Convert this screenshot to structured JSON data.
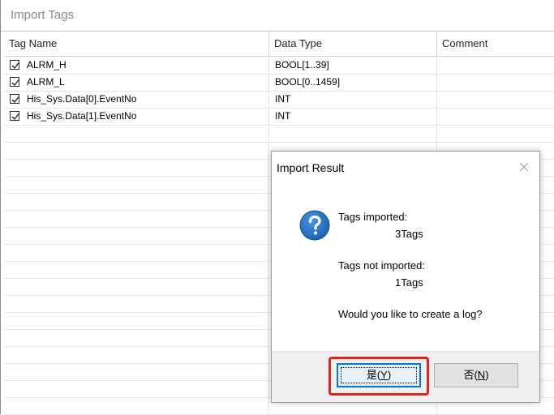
{
  "window": {
    "title": "Import Tags"
  },
  "table": {
    "columns": [
      "Tag Name",
      "Data Type",
      "Comment"
    ],
    "rows": [
      {
        "checked": true,
        "name": "ALRM_H",
        "type": "BOOL[1..39]",
        "comment": ""
      },
      {
        "checked": true,
        "name": "ALRM_L",
        "type": "BOOL[0..1459]",
        "comment": ""
      },
      {
        "checked": true,
        "name": "His_Sys.Data[0].EventNo",
        "type": "INT",
        "comment": ""
      },
      {
        "checked": true,
        "name": "His_Sys.Data[1].EventNo",
        "type": "INT",
        "comment": ""
      }
    ]
  },
  "dialog": {
    "title": "Import Result",
    "imported_label": "Tags imported:",
    "imported_value": "3Tags",
    "not_imported_label": "Tags not imported:",
    "not_imported_value": "1Tags",
    "question": "Would you like to create a log?",
    "yes_label": "是(",
    "yes_key": "Y",
    "yes_close": ")",
    "no_label": "否(",
    "no_key": "N",
    "no_close": ")"
  },
  "colors": {
    "accent": "#0078d7",
    "highlight": "#e8231c",
    "icon_blue": "#1f6fc5"
  }
}
